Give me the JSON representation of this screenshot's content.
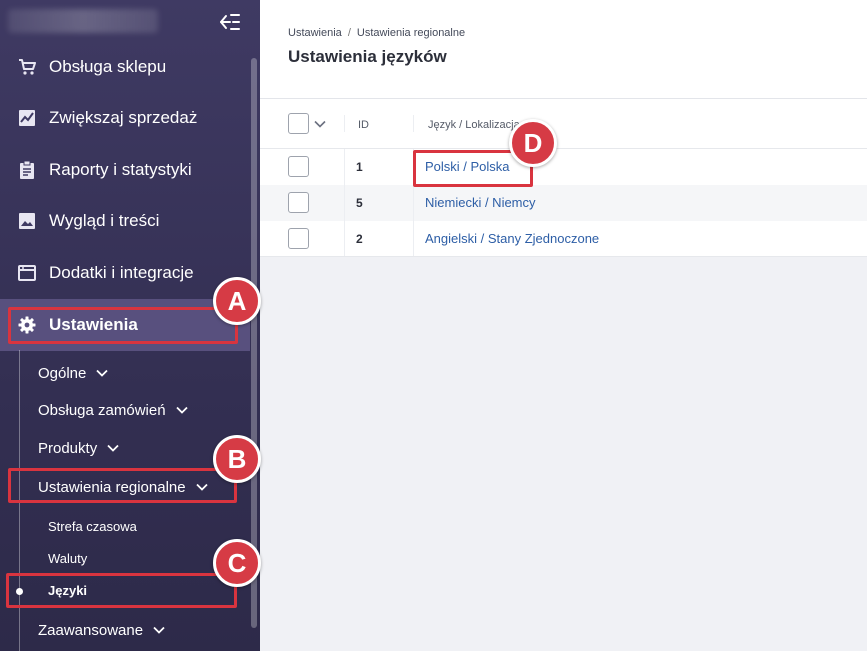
{
  "sidebar": {
    "menu": [
      {
        "label": "Obsługa sklepu",
        "icon": "cart-icon"
      },
      {
        "label": "Zwiększaj sprzedaż",
        "icon": "chart-line-icon"
      },
      {
        "label": "Raporty i statystyki",
        "icon": "clipboard-icon"
      },
      {
        "label": "Wygląd i treści",
        "icon": "image-icon"
      },
      {
        "label": "Dodatki i integracje",
        "icon": "window-icon"
      },
      {
        "label": "Ustawienia",
        "icon": "gear-icon",
        "active": true
      }
    ],
    "settings_submenu": [
      {
        "label": "Ogólne"
      },
      {
        "label": "Obsługa zamówień"
      },
      {
        "label": "Produkty"
      },
      {
        "label": "Ustawienia regionalne",
        "expanded": true
      },
      {
        "label": "Zaawansowane"
      }
    ],
    "regional_submenu": [
      {
        "label": "Strefa czasowa"
      },
      {
        "label": "Waluty"
      },
      {
        "label": "Języki",
        "active": true
      }
    ]
  },
  "header": {
    "breadcrumb": [
      "Ustawienia",
      "Ustawienia regionalne"
    ],
    "breadcrumb_separator": "/",
    "title": "Ustawienia języków"
  },
  "table": {
    "columns": {
      "id": "ID",
      "language": "Język / Lokalizacja"
    },
    "rows": [
      {
        "id": "1",
        "language": "Polski / Polska"
      },
      {
        "id": "5",
        "language": "Niemiecki / Niemcy"
      },
      {
        "id": "2",
        "language": "Angielski / Stany Zjednoczone"
      }
    ]
  },
  "annotations": {
    "a": "A",
    "b": "B",
    "c": "C",
    "d": "D",
    "color": "#d9343f"
  }
}
